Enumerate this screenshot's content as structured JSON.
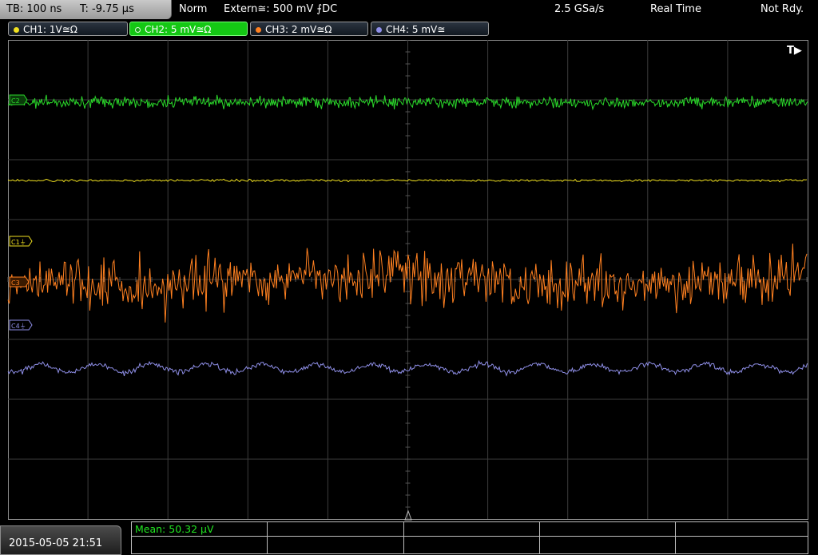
{
  "status": {
    "timebase": "TB: 100 ns",
    "trigger_offset": "T: -9.75 µs",
    "trigger_mode": "Norm",
    "trigger_source": "Extern≅: 500 mV ⨍DC",
    "sample_rate": "2.5 GSa/s",
    "acq_mode": "Real Time",
    "ready_state": "Not Rdy."
  },
  "channels": [
    {
      "label": "CH1: 1V≅Ω",
      "color": "#f0e020"
    },
    {
      "label": "CH2: 5 mV≅Ω",
      "color": "#2ad82a"
    },
    {
      "label": "CH3: 2 mV≅Ω",
      "color": "#ff8020"
    },
    {
      "label": "CH4: 5 mV≅",
      "color": "#8f8fe8"
    }
  ],
  "markers": {
    "trigger": "T▶",
    "c1": "C1⏚",
    "c2": "C2",
    "c3": "C3",
    "c4": "C4⏚"
  },
  "bottom": {
    "datetime": "2015-05-05 21:51",
    "mean": "Mean: 50.32 µV"
  },
  "colors": {
    "grid": "#4a4a4a",
    "ch1": "#f0e020",
    "ch2": "#2ad82a",
    "ch3": "#ff8020",
    "ch4": "#8f8fe8"
  }
}
